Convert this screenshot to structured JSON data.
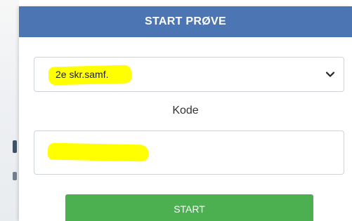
{
  "modal": {
    "title": "START PRØVE",
    "header_color": "#4b75b3"
  },
  "class_select": {
    "selected": "2e skr.samf.",
    "icon": "chevron-down-icon"
  },
  "code_field": {
    "label": "Kode",
    "value": ""
  },
  "start_button": {
    "label": "START",
    "color": "#4caf50"
  },
  "highlight_color": "#ffff00"
}
